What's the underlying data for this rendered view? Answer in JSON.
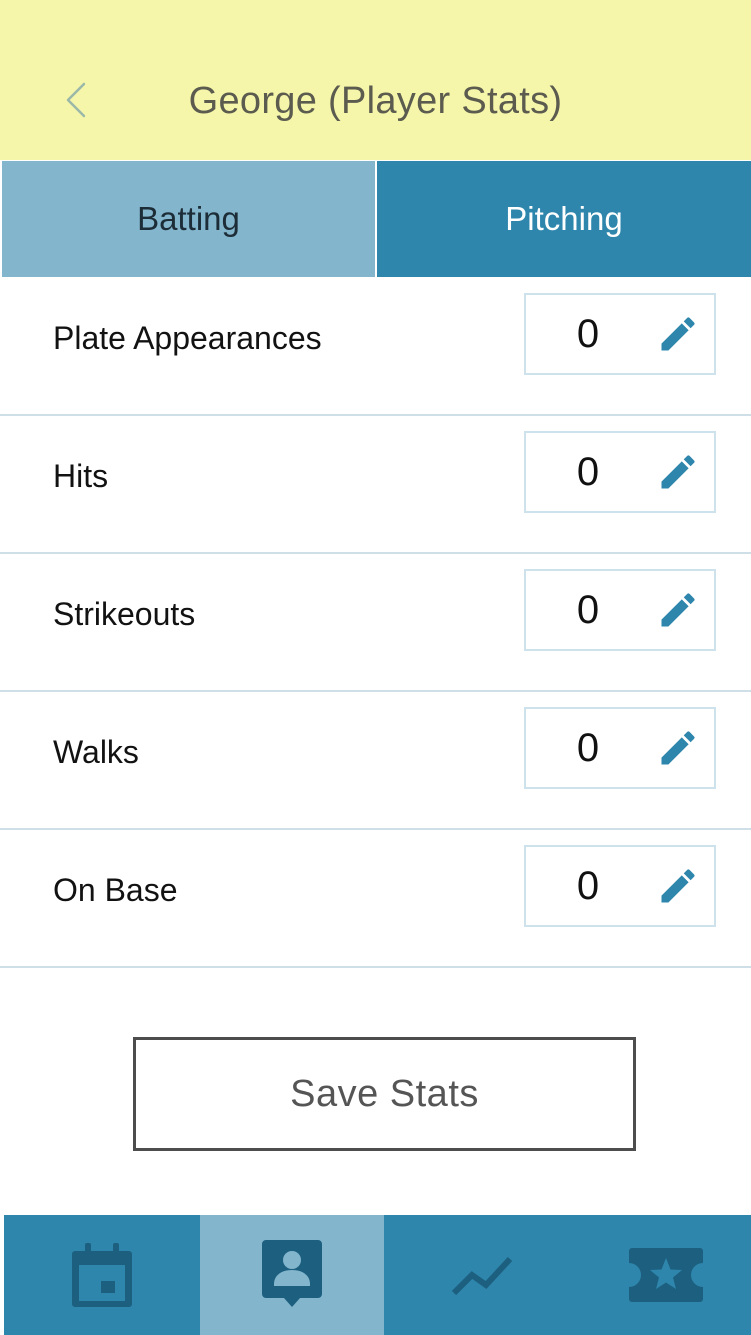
{
  "header": {
    "title": "George (Player Stats)",
    "back_icon": "chevron-left-icon"
  },
  "tabs": [
    {
      "label": "Batting",
      "active": true
    },
    {
      "label": "Pitching",
      "active": false
    }
  ],
  "stats": [
    {
      "label": "Plate Appearances",
      "value": "0"
    },
    {
      "label": "Hits",
      "value": "0"
    },
    {
      "label": "Strikeouts",
      "value": "0"
    },
    {
      "label": "Walks",
      "value": "0"
    },
    {
      "label": "On Base",
      "value": "0"
    }
  ],
  "save_button": {
    "label": "Save Stats"
  },
  "bottom_nav": [
    {
      "icon": "calendar-icon",
      "active": false
    },
    {
      "icon": "player-profile-icon",
      "active": true
    },
    {
      "icon": "trend-line-icon",
      "active": false
    },
    {
      "icon": "ticket-star-icon",
      "active": false
    }
  ],
  "colors": {
    "header_bg": "#f6f6aa",
    "tab_active_bg": "#83b5cc",
    "tab_inactive_bg": "#2e86ad",
    "accent": "#2e86ad",
    "nav_icon": "#1d5f7f"
  }
}
